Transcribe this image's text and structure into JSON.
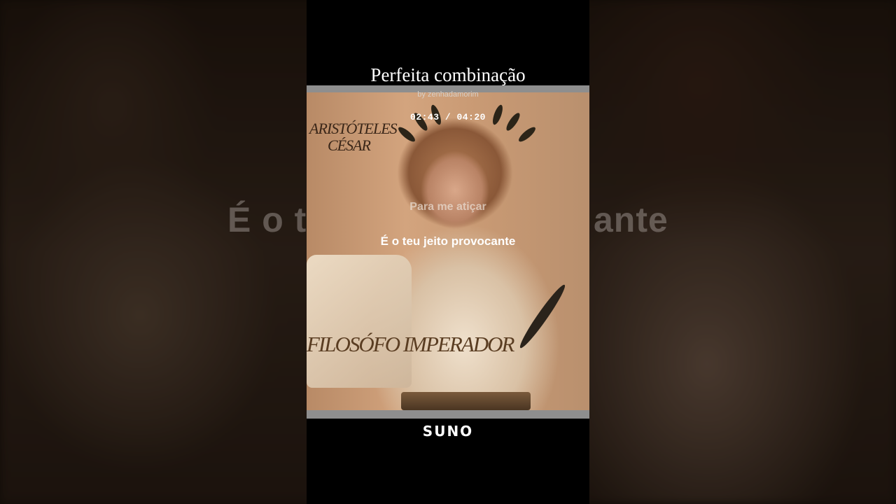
{
  "song": {
    "title": "Perfeita combinação",
    "artist": "by zenhadamorim",
    "time": "02:43 / 04:20"
  },
  "lyrics": {
    "previous": "Para me atiçar",
    "current": "É o teu jeito provocante"
  },
  "background_lyric": {
    "left_fragment": "É o t",
    "right_fragment": "ante"
  },
  "artwork": {
    "caption_top_line1": "ARISTÓTELES",
    "caption_top_line2": "CÉSAR",
    "caption_bottom": "FILOSÓFO IMPERADOR"
  },
  "brand": {
    "logo_text": "SUNO"
  },
  "colors": {
    "background": "#000000",
    "text": "#ffffff",
    "artwork_frame": "#8e8e8e"
  }
}
